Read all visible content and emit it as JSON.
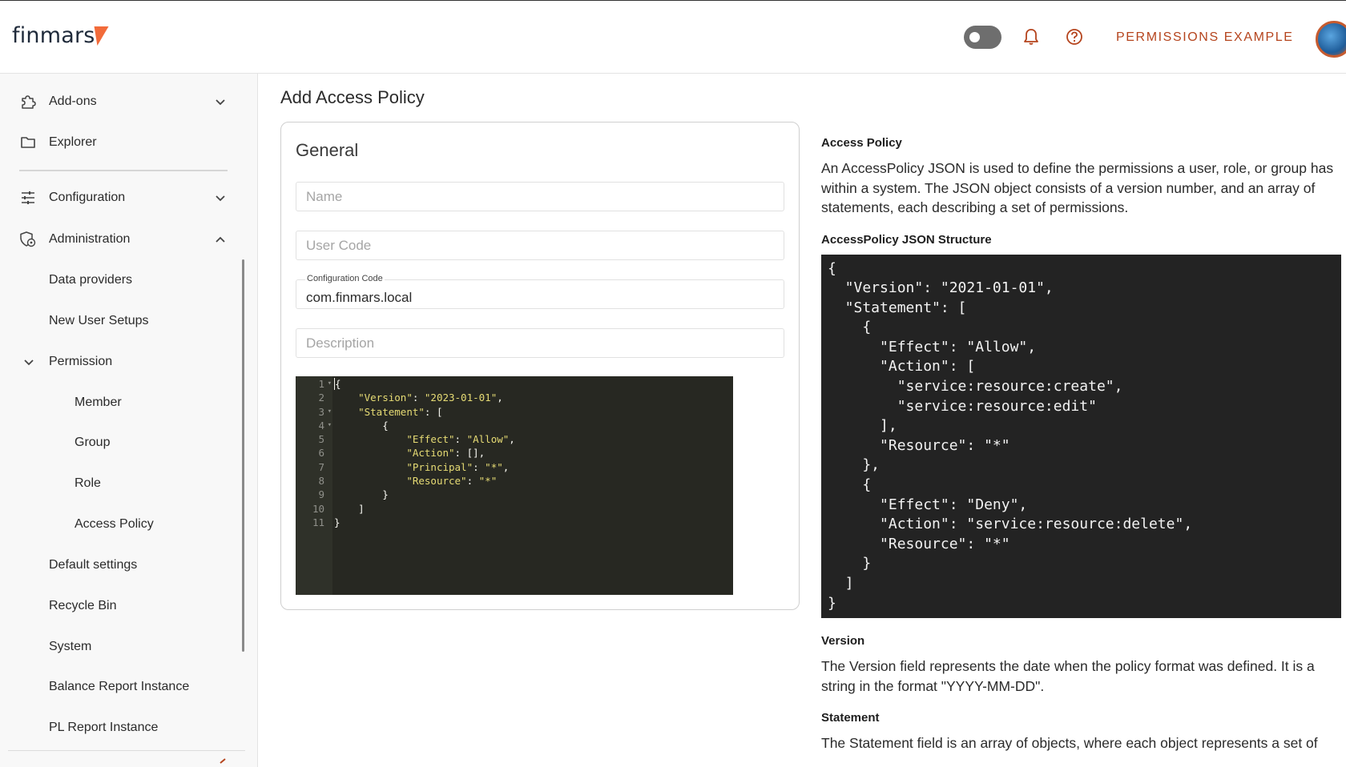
{
  "app": {
    "logo_text": "finmars",
    "workspace_name": "PERMISSIONS EXAMPLE",
    "accent_color": "#b5441d",
    "logo_mark_color": "#f26b3a"
  },
  "header_icons": {
    "theme_toggle": "toggle-switch-icon",
    "notifications": "bell-icon",
    "help": "help-circle-icon",
    "avatar": "user-avatar"
  },
  "sidebar": {
    "top_items": [
      {
        "label": "Add-ons",
        "icon": "puzzle-icon"
      },
      {
        "label": "Explorer",
        "icon": "folder-icon"
      }
    ],
    "sections": [
      {
        "label": "Configuration",
        "icon": "sliders-icon"
      },
      {
        "label": "Administration",
        "icon": "admin-shield-icon"
      }
    ],
    "admin_items": [
      "Data providers",
      "New User Setups"
    ],
    "permission_label": "Permission",
    "permission_items": [
      "Member",
      "Group",
      "Role",
      "Access Policy"
    ],
    "more_items": [
      "Default settings",
      "Recycle Bin",
      "System",
      "Balance Report Instance",
      "PL Report Instance"
    ]
  },
  "main": {
    "page_title": "Add Access Policy",
    "card_title": "General",
    "fields": {
      "name_placeholder": "Name",
      "user_code_placeholder": "User Code",
      "config_code_label": "Configuration Code",
      "config_code_value": "com.finmars.local",
      "description_placeholder": "Description"
    },
    "editor": {
      "line_numbers": [
        "1",
        "2",
        "3",
        "4",
        "5",
        "6",
        "7",
        "8",
        "9",
        "10",
        "11"
      ],
      "lines": [
        "{",
        "    \"Version\": \"2023-01-01\",",
        "    \"Statement\": [",
        "        {",
        "            \"Effect\": \"Allow\",",
        "            \"Action\": [],",
        "            \"Principal\": \"*\",",
        "            \"Resource\": \"*\"",
        "        }",
        "    ]",
        "}"
      ]
    }
  },
  "help": {
    "access_policy_title": "Access Policy",
    "access_policy_text": "An AccessPolicy JSON is used to define the permissions a user, role, or group has within a system. The JSON object consists of a version number, and an array of statements, each describing a set of permissions.",
    "structure_title": "AccessPolicy JSON Structure",
    "structure_json": "{\n  \"Version\": \"2021-01-01\",\n  \"Statement\": [\n    {\n      \"Effect\": \"Allow\",\n      \"Action\": [\n        \"service:resource:create\",\n        \"service:resource:edit\"\n      ],\n      \"Resource\": \"*\"\n    },\n    {\n      \"Effect\": \"Deny\",\n      \"Action\": \"service:resource:delete\",\n      \"Resource\": \"*\"\n    }\n  ]\n}",
    "version_title": "Version",
    "version_text": "The Version field represents the date when the policy format was defined. It is a string in the format \"YYYY-MM-DD\".",
    "statement_title": "Statement",
    "statement_text": "The Statement field is an array of objects, where each object represents a set of"
  }
}
